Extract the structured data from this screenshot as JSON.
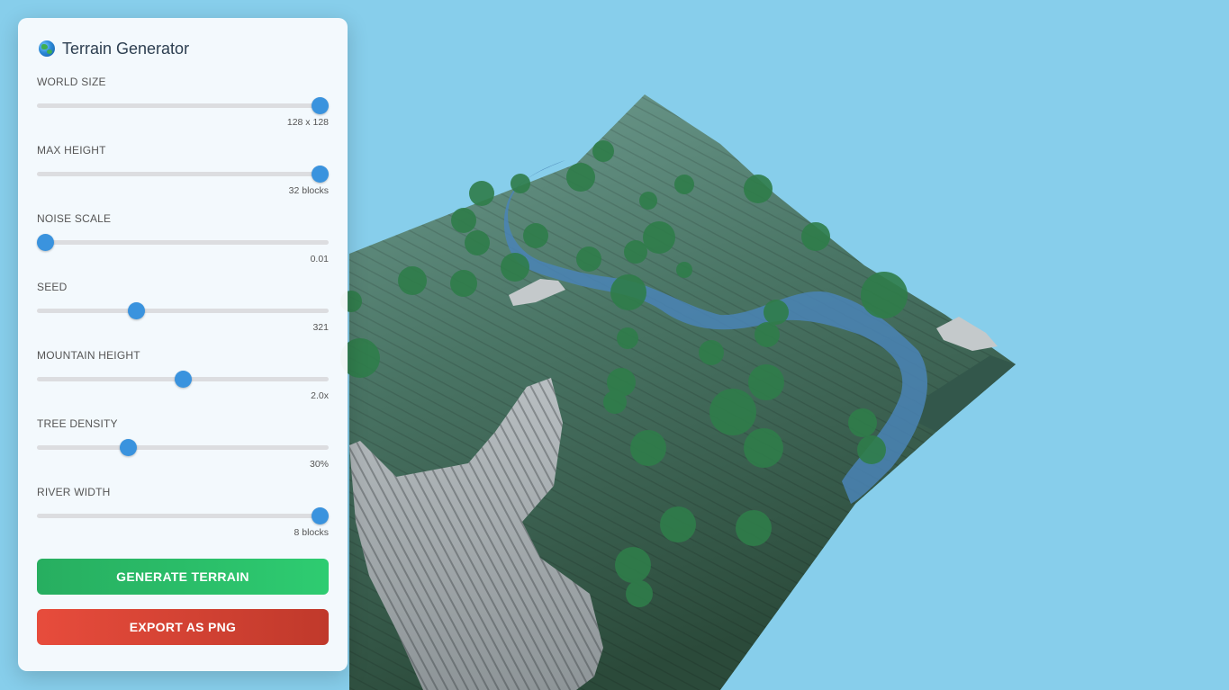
{
  "app": {
    "title": "Terrain Generator",
    "icon": "globe-icon"
  },
  "controls": [
    {
      "label": "WORLD SIZE",
      "value": "128 x 128",
      "level": 1.0
    },
    {
      "label": "MAX HEIGHT",
      "value": "32 blocks",
      "level": 1.0
    },
    {
      "label": "NOISE SCALE",
      "value": "0.01",
      "level": 0.0
    },
    {
      "label": "SEED",
      "value": "321",
      "level": 0.33
    },
    {
      "label": "MOUNTAIN HEIGHT",
      "value": "2.0x",
      "level": 0.5
    },
    {
      "label": "TREE DENSITY",
      "value": "30%",
      "level": 0.3
    },
    {
      "label": "RIVER WIDTH",
      "value": "8 blocks",
      "level": 1.0
    }
  ],
  "buttons": {
    "generate": "GENERATE TERRAIN",
    "export": "EXPORT AS PNG"
  },
  "colors": {
    "sky": "#87ceeb",
    "accent": "#3a93de",
    "generate": "#2ecc71",
    "export": "#e74c3c",
    "grass": "#3f6b5b",
    "water": "#4a84b6",
    "stone": "#9aa2a6",
    "tree": "#2f7d4a"
  }
}
